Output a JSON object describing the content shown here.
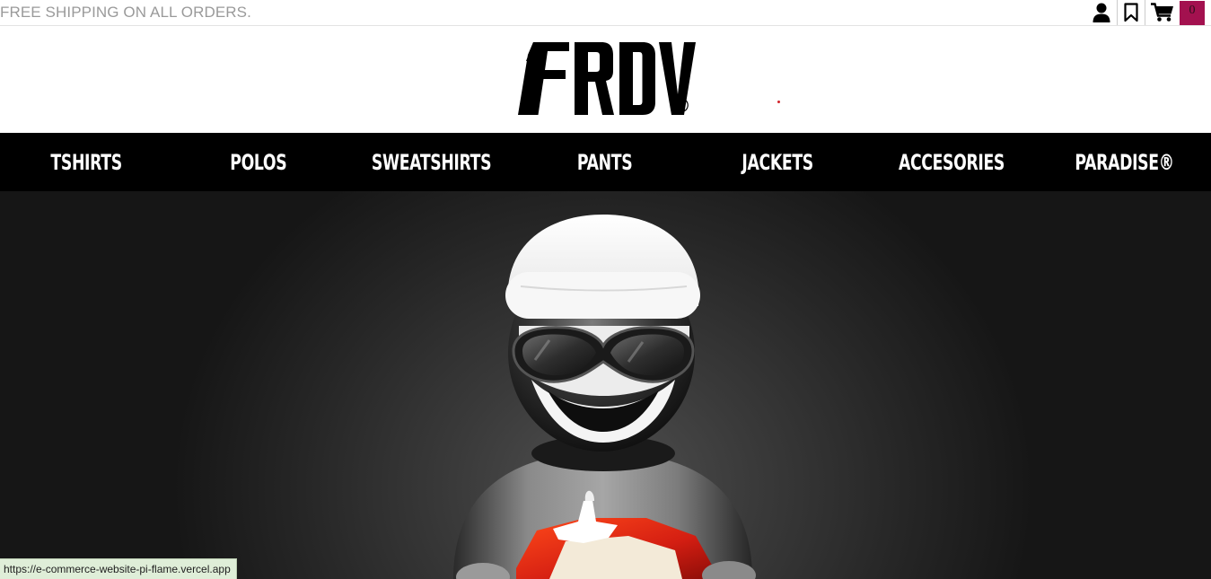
{
  "topbar": {
    "promo_text": "FREE SHIPPING ON ALL ORDERS.",
    "cart_count": "0",
    "icons": [
      "user-icon",
      "bookmark-icon",
      "cart-icon"
    ]
  },
  "brand": {
    "logo_text": "FRDV",
    "registered_mark": "®"
  },
  "nav": {
    "items": [
      {
        "label": "TSHIRTS"
      },
      {
        "label": "POLOS"
      },
      {
        "label": "SWEATSHIRTS"
      },
      {
        "label": "PANTS"
      },
      {
        "label": "JACKETS"
      },
      {
        "label": "ACCESORIES"
      },
      {
        "label": "PARADISE®"
      }
    ]
  },
  "hero": {
    "image": "character-with-beanie-and-gift-illustration"
  },
  "status_bar": {
    "url": "https://e-commerce-website-pi-flame.vercel.app"
  },
  "colors": {
    "cart_badge": "#a3114f",
    "nav_background": "#000000",
    "promo_text": "#9a9a9a"
  }
}
